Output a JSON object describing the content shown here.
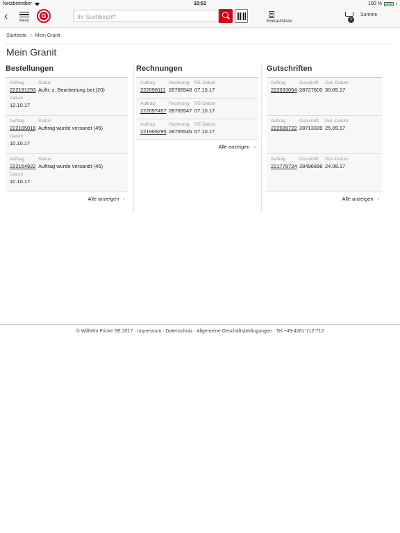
{
  "status_bar": {
    "carrier": "Netzbetreiber",
    "time": "10:51",
    "battery": "100 %"
  },
  "header": {
    "menu_label": "Menü",
    "logo_letter": "G",
    "search_placeholder": "Ihr Suchbegriff",
    "list_label": "Einkaufsliste",
    "cart_count": "1",
    "sum_label": "Summe"
  },
  "breadcrumb": [
    "Startseite",
    "Mein Granit"
  ],
  "page_title": "Mein Granit",
  "orders": {
    "title": "Bestellungen",
    "labels": {
      "auftrag": "Auftrag",
      "status": "Status",
      "datum": "Datum"
    },
    "items": [
      {
        "auftrag": "222191293",
        "status": "Auftr. z. Bearbeitung ber.(20)",
        "datum": "12.10.17"
      },
      {
        "auftrag": "222165018",
        "status": "Auftrag wurde versandt (45)",
        "datum": "10.10.17"
      },
      {
        "auftrag": "222164922",
        "status": "Auftrag wurde versandt (45)",
        "datum": "10.10.17"
      }
    ],
    "show_all": "Alle anzeigen"
  },
  "invoices": {
    "title": "Rechnungen",
    "labels": {
      "auftrag": "Auftrag",
      "rechnung": "Rechnung",
      "datum": "RE-Datum"
    },
    "items": [
      {
        "auftrag": "222098111",
        "rechnung": "28765548",
        "datum": "07.10.17"
      },
      {
        "auftrag": "222097457",
        "rechnung": "28765547",
        "datum": "07.10.17"
      },
      {
        "auftrag": "221909295",
        "rechnung": "28765546",
        "datum": "07.10.17"
      }
    ],
    "show_all": "Alle anzeigen"
  },
  "credits": {
    "title": "Gutschriften",
    "labels": {
      "auftrag": "Auftrag",
      "gutschrift": "Gutschrift",
      "datum": "Gut.-Datum"
    },
    "items": [
      {
        "auftrag": "222033054",
        "gutschrift": "28727600",
        "datum": "30.09.17"
      },
      {
        "auftrag": "222039722",
        "gutschrift": "28713339",
        "datum": "25.09.17"
      },
      {
        "auftrag": "221776724",
        "gutschrift": "28496898",
        "datum": "24.08.17"
      }
    ],
    "show_all": "Alle anzeigen"
  },
  "footer": "© Wilhelm Fricke SE 2017 · Impressum · Datenschutz · Allgemeine Geschäftsbedingungen · Tel.+49-4281-712-712",
  "colors": {
    "brand_red": "#d8001a",
    "card_bg": "#f7f7f7"
  }
}
